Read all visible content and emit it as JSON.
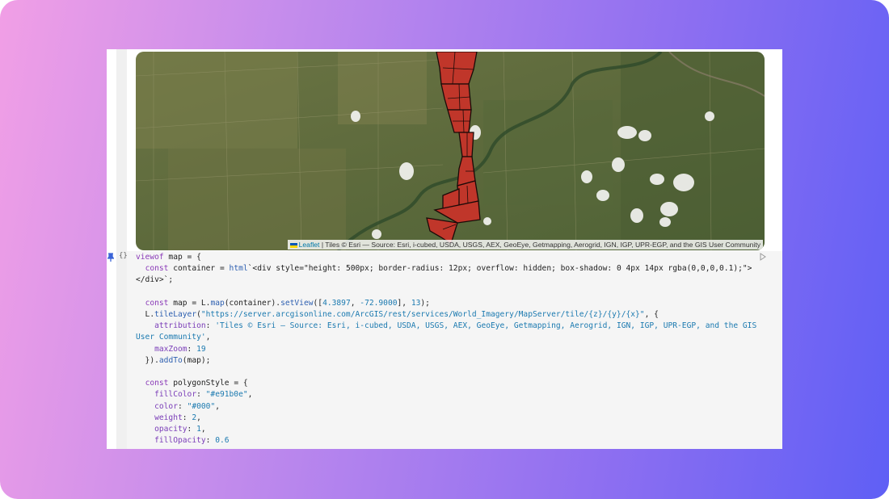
{
  "colors": {
    "polygon_fill": "#e91b0e",
    "polygon_stroke": "#000",
    "link": "#0078a8"
  },
  "map": {
    "attribution_link": "Leaflet",
    "attribution_text": "| Tiles © Esri — Source: Esri, i-cubed, USDA, USGS, AEX, GeoEye, Getmapping, Aerogrid, IGN, IGP, UPR-EGP, and the GIS User Community"
  },
  "cell": {
    "pin_icon": "pin-icon",
    "braces_label": "{}",
    "run_icon": "play-icon",
    "code": {
      "l1a": "viewof",
      "l1b": " map = {",
      "l2a": "  ",
      "l2b": "const",
      "l2c": " container = ",
      "l2d": "html",
      "l2e": "`<div style=\"height: 500px; border-radius: 12px; overflow: hidden; box-shadow: 0 4px 14px rgba(0,0,0,0.1);\">",
      "l3": "</div>`;",
      "l5a": "  ",
      "l5b": "const",
      "l5c": " map = L.",
      "l5d": "map",
      "l5e": "(container).",
      "l5f": "setView",
      "l5g": "([",
      "l5h": "4.3897",
      "l5i": ", ",
      "l5j": "-72.9000",
      "l5k": "], ",
      "l5l": "13",
      "l5m": ");",
      "l6a": "  L.",
      "l6b": "tileLayer",
      "l6c": "(",
      "l6d": "\"https://server.arcgisonline.com/ArcGIS/rest/services/World_Imagery/MapServer/tile/{z}/{y}/{x}\"",
      "l6e": ", {",
      "l7a": "    ",
      "l7b": "attribution",
      "l7c": ": ",
      "l7d": "'Tiles © Esri — Source: Esri, i-cubed, USDA, USGS, AEX, GeoEye, Getmapping, Aerogrid, IGN, IGP, UPR-EGP, and the GIS",
      "l8": "User Community'",
      "l8b": ",",
      "l9a": "    ",
      "l9b": "maxZoom",
      "l9c": ": ",
      "l9d": "19",
      "l10a": "  }).",
      "l10b": "addTo",
      "l10c": "(map);",
      "l12a": "  ",
      "l12b": "const",
      "l12c": " polygonStyle = {",
      "l13a": "    ",
      "l13b": "fillColor",
      "l13c": ": ",
      "l13d": "\"#e91b0e\"",
      "l13e": ",",
      "l14a": "    ",
      "l14b": "color",
      "l14c": ": ",
      "l14d": "\"#000\"",
      "l14e": ",",
      "l15a": "    ",
      "l15b": "weight",
      "l15c": ": ",
      "l15d": "2",
      "l15e": ",",
      "l16a": "    ",
      "l16b": "opacity",
      "l16c": ": ",
      "l16d": "1",
      "l16e": ",",
      "l17a": "    ",
      "l17b": "fillOpacity",
      "l17c": ": ",
      "l17d": "0.6"
    }
  }
}
